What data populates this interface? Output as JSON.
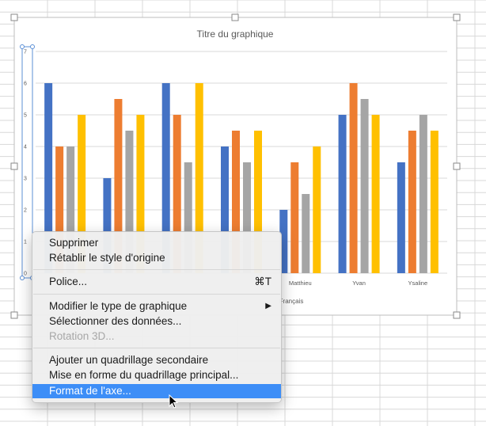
{
  "chart_data": {
    "type": "bar",
    "title": "Titre du graphique",
    "categories": [
      "",
      "",
      "",
      "",
      "Matthieu",
      "Yvan",
      "Ysaline"
    ],
    "series": [
      {
        "values": [
          6,
          3,
          6,
          4,
          2,
          5,
          3.5
        ]
      },
      {
        "values": [
          4,
          5.5,
          5,
          4.5,
          3.5,
          6,
          4.5
        ]
      },
      {
        "values": [
          4,
          4.5,
          3.5,
          3.5,
          2.5,
          5.5,
          5
        ]
      },
      {
        "values": [
          5,
          5,
          6,
          4.5,
          4,
          5,
          4.5
        ]
      }
    ],
    "colors": [
      "#4472c4",
      "#ed7d31",
      "#a5a5a5",
      "#ffc000"
    ],
    "y_ticks": [
      "0",
      "1",
      "2",
      "3",
      "4",
      "5",
      "6",
      "7"
    ],
    "ylim": [
      0,
      7
    ],
    "xlabel": "Français",
    "grid": true
  },
  "context_menu": {
    "items": [
      {
        "label": "Supprimer"
      },
      {
        "label": "Rétablir le style d'origine"
      },
      {
        "label": "Police...",
        "shortcut": "⌘T"
      },
      {
        "label": "Modifier le type de graphique",
        "submenu_icon": "triangle-right-icon"
      },
      {
        "label": "Sélectionner des données..."
      },
      {
        "label": "Rotation 3D...",
        "disabled": true
      },
      {
        "label": "Ajouter un quadrillage secondaire"
      },
      {
        "label": "Mise en forme du quadrillage principal..."
      },
      {
        "label": "Format de l'axe...",
        "selected": true
      }
    ]
  },
  "icons": {
    "cursor": "arrow-cursor-icon"
  },
  "colors": {
    "selection": "#3d8ef7",
    "sheet_grid": "#d8d8d8"
  }
}
